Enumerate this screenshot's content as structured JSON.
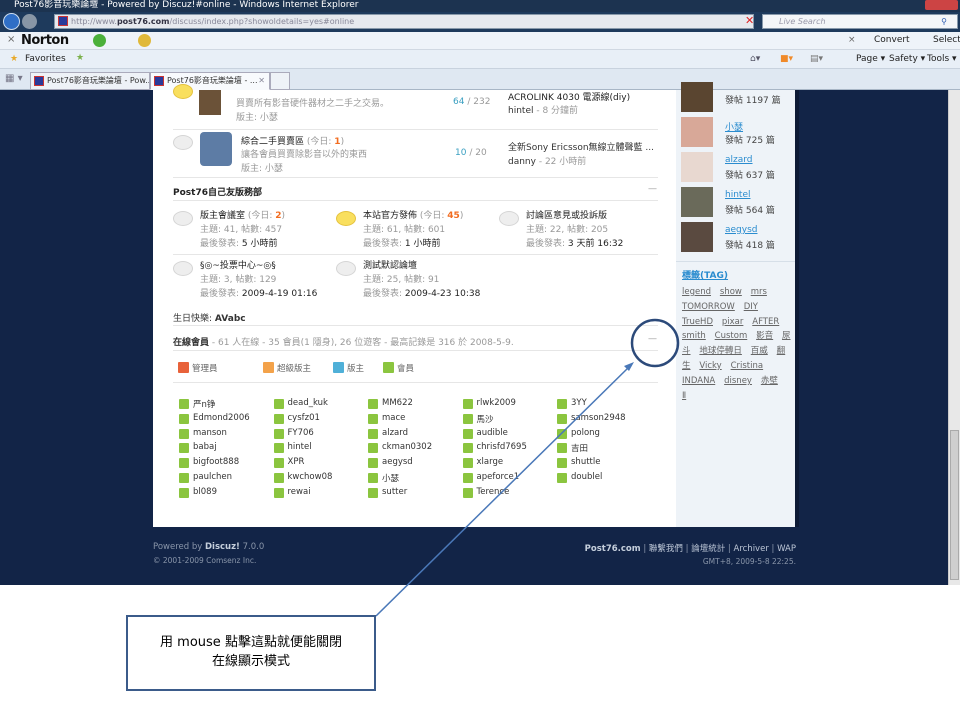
{
  "browser": {
    "title": "Post76影音玩樂論壇 - Powered by Discuz!#online - Windows Internet Explorer",
    "url_prefix": "http://www.",
    "url_domain": "post76.com",
    "url_path": "/discuss/index.php?showoldetails=yes#online",
    "search_placeholder": "Live Search",
    "norton": "Norton",
    "convert": "Convert",
    "select": "Select",
    "favorites": "Favorites",
    "tabs": [
      "Post76影音玩樂論壇 - Pow...",
      "Post76影音玩樂論壇 - ..."
    ],
    "page": "Page",
    "safety": "Safety",
    "tools": "Tools"
  },
  "forums_top": [
    {
      "desc": "買賣所有影音硬件器材之二手之交易。",
      "mod": "版主: 小瑟",
      "topics": "64",
      "posts": "232",
      "last_title": "ACROLINK 4030 電源線(diy)",
      "last_user": "hintel",
      "last_time": "- 8 分鐘前"
    },
    {
      "name": "綜合二手買賣區",
      "today_label": "(今日: ",
      "today": "1",
      "today_end": ")",
      "desc": "讓各會員買賣除影音以外的東西",
      "mod": "版主: 小瑟",
      "topics": "10",
      "posts": "20",
      "last_title": "全新Sony Ericsson無線立體聲藍 ...",
      "last_user": "danny",
      "last_time": "- 22 小時前"
    }
  ],
  "group": {
    "title": "Post76自己友版務部",
    "forums": [
      {
        "name": "版主會議室",
        "today": "2",
        "stats": "主題: 41, 帖數: 457",
        "last_label": "最後發表:",
        "last": "5 小時前",
        "new": false
      },
      {
        "name": "本站官方發佈",
        "today": "45",
        "stats": "主題: 61, 帖數: 601",
        "last_label": "最後發表:",
        "last": "1 小時前",
        "new": true
      },
      {
        "name": "討論區意見或投訴版",
        "today": "",
        "stats": "主題: 22, 帖數: 205",
        "last_label": "最後發表:",
        "last": "3 天前 16:32",
        "new": false
      },
      {
        "name": "§◎~投票中心~◎§",
        "today": "",
        "stats": "主題: 3, 帖數: 129",
        "last_label": "最後發表:",
        "last": "2009-4-19 01:16",
        "new": false
      },
      {
        "name": "測試默認論壇",
        "today": "",
        "stats": "主題: 25, 帖數: 91",
        "last_label": "最後發表:",
        "last": "2009-4-23 10:38",
        "new": false
      }
    ]
  },
  "birthday": {
    "label": "生日快樂:",
    "name": "AVabc"
  },
  "online": {
    "label": "在線會員",
    "text": "- 61 人在線 - 35 會員(1 隱身), 26 位遊客 - 最高記錄是 316 於 2008-5-9.",
    "collapse": "—",
    "legend": [
      {
        "label": "管理員",
        "color": "#e8623a"
      },
      {
        "label": "超級版主",
        "color": "#f3a24a"
      },
      {
        "label": "版主",
        "color": "#4fb0d8"
      },
      {
        "label": "會員",
        "color": "#8bc53f"
      }
    ],
    "users": [
      "严n铮",
      "dead_kuk",
      "MM622",
      "rlwk2009",
      "3YY",
      "Edmond2006",
      "cysfz01",
      "mace",
      "馬沙",
      "samson2948",
      "manson",
      "FY706",
      "alzard",
      "audible",
      "polong",
      "babaj",
      "hintel",
      "ckman0302",
      "chrisfd7695",
      "吉田",
      "bigfoot888",
      "XPR",
      "aegysd",
      "xlarge",
      "shuttle",
      "paulchen",
      "kwchow08",
      "小瑟",
      "apeforce1",
      "doublel",
      "bl089",
      "rewai",
      "sutter",
      "Terence"
    ]
  },
  "sidebar": {
    "posters": [
      {
        "name": "",
        "count": "發帖 1197 篇"
      },
      {
        "name": "小瑟",
        "count": "發帖 725 篇"
      },
      {
        "name": "alzard",
        "count": "發帖 637 篇"
      },
      {
        "name": "hintel",
        "count": "發帖 564 篇"
      },
      {
        "name": "aegysd",
        "count": "發帖 418 篇"
      }
    ],
    "tag_title": "標籤(TAG)",
    "tags": [
      "legend",
      "show",
      "mrs",
      "TOMORROW",
      "DIY",
      "TrueHD",
      "pixar",
      "AFTER",
      "smith",
      "Custom",
      "影音",
      "尿斗",
      "地球停轉日",
      "百威",
      "翻生",
      "Vicky",
      "Cristina",
      "INDANA",
      "disney",
      "赤壁",
      "Ⅱ"
    ]
  },
  "footer": {
    "powered": "Powered by",
    "brand": "Discuz!",
    "version": "7.0.0",
    "copyright": "© 2001-2009 Comsenz Inc.",
    "site": "Post76.com",
    "links": [
      "聯繫我們",
      "論壇統計",
      "Archiver",
      "WAP"
    ],
    "time": "GMT+8, 2009-5-8 22:25."
  },
  "annotation": {
    "line1": "用 mouse 點擊這點就便能關閉",
    "line2": "在線顯示模式"
  }
}
